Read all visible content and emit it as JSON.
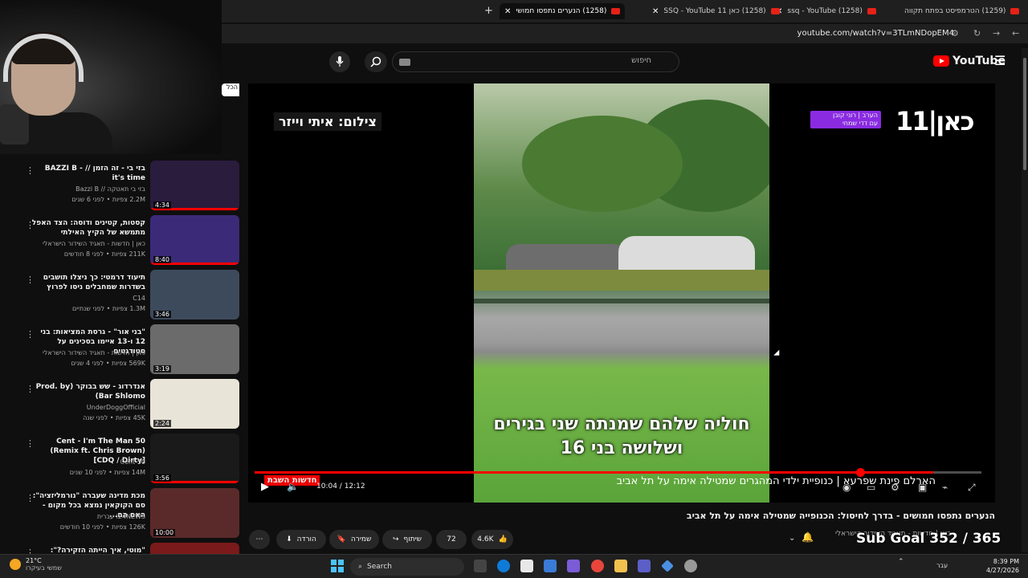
{
  "browser": {
    "tabs": [
      {
        "label": "(1259) הטרמפיסט בפתח תקווה",
        "active": false
      },
      {
        "label": "(1258) ssq - YouTube",
        "active": false
      },
      {
        "label": "(1258) כאן 11 SSQ - YouTube",
        "active": false
      },
      {
        "label": "(1258) הנערים נתפסו חמושי",
        "active": true
      }
    ],
    "url": "youtube.com/watch?v=3TLmNDopEM4"
  },
  "header": {
    "logo_text": "YouTube",
    "search_placeholder": "חיפוש"
  },
  "sidebar": {
    "items": [
      {
        "title": "בזי בי - זה הזמן // BAZZI B - it's time",
        "channel": "בזי בי תאטקה // Bazzi B",
        "meta": "2.2M צפיות • לפני 6 שנים",
        "duration": "4:34",
        "color": "#2a1c3d"
      },
      {
        "title": "קסטות, קטינים ודוסה: הצד האפל מתמשא של הקיץ האילתי",
        "channel": "כאן | חדשות - תאגיד השידור הישראלי",
        "meta": "211K צפיות • לפני 8 חודשים",
        "duration": "8:40",
        "color": "#3b2a78"
      },
      {
        "title": "תיעוד דרמטי: כך ניצלו תושבים בשדרות שמחבלים ניסו לפרוץ",
        "channel": "C14",
        "meta": "1.3M צפיות • לפני שנתיים",
        "duration": "3:46",
        "color": "#3d4a5c"
      },
      {
        "title": "\"בני אור\" - גרסת המציאות: בני 12 ו-13 איימו בסכינים על סטודנטים",
        "channel": "כאן | חדשות - תאגיד השידור הישראלי",
        "meta": "569K צפיות • לפני 4 שנים",
        "duration": "3:19",
        "color": "#6b6b6b"
      },
      {
        "title": "אנדרדוג - שש בבוקר (Prod. by Bar Shlomo)",
        "channel": "UnderDoggOfficial",
        "meta": "45K צפיות • לפני שנה",
        "duration": "2:24",
        "color": "#e9e4d8"
      },
      {
        "title": "50 Cent - I'm The Man (Remix ft. Chris Brown) [CDQ / Dirty]",
        "channel": "50 Cent",
        "meta": "14M צפיות • לפני 10 שנים",
        "duration": "3:56",
        "color": "#1a1a1a"
      },
      {
        "title": "מכת מדינה שעברה \"נורמליזציה\": סם הקוקאין נמצא בכל מקום - האם הם...",
        "channel": "i24NEWS עברית",
        "meta": "126K צפיות • לפני 10 חודשים",
        "duration": "10:00",
        "color": "#5a2a2a"
      },
      {
        "title": "\"מוטי, איך הייתה הזקירה?\": משפחות",
        "channel": "",
        "meta": "",
        "duration": "",
        "color": "#7a1a1a"
      }
    ],
    "side_tab": "הכל"
  },
  "player": {
    "credit": "צילום: איתי וייזר",
    "channel_logo": "כאן|11",
    "badge_line1": "הערב | רוני קובן",
    "badge_line2": "עם דדי שמחי",
    "subtitle_line1": "חוליה שלהם שמנתה שני בגירים",
    "subtitle_line2": "ושלושה בני 16",
    "ticker_tag": "חדשות השבת",
    "ticker": "הארלם פינת שפרעא | כנופיית ילדי המהגרים שמטילה אימה על תל אביב",
    "time": "10:04 / 12:12",
    "progress": 0.825
  },
  "below": {
    "title": "הנערים נתפסו חמושים - בדרך לחיסול: הכנופייה שמטילה אימה על תל אביב",
    "channel": "כאן | חדשות - תאגיד השידור הישראלי",
    "likes": "4.6K",
    "comments": "72",
    "share": "שיתוף",
    "save": "שמירה",
    "download": "הורדה",
    "sub_goal": "Sub Goal 352 / 365"
  },
  "taskbar": {
    "temp": "21°C",
    "weather": "שמשי בעיקרו",
    "search": "Search",
    "lang": "עבר",
    "time": "8:39 PM",
    "date": "4/27/2026"
  },
  "colors": {
    "accent": "#ff0000",
    "badge": "#8a2be2"
  }
}
